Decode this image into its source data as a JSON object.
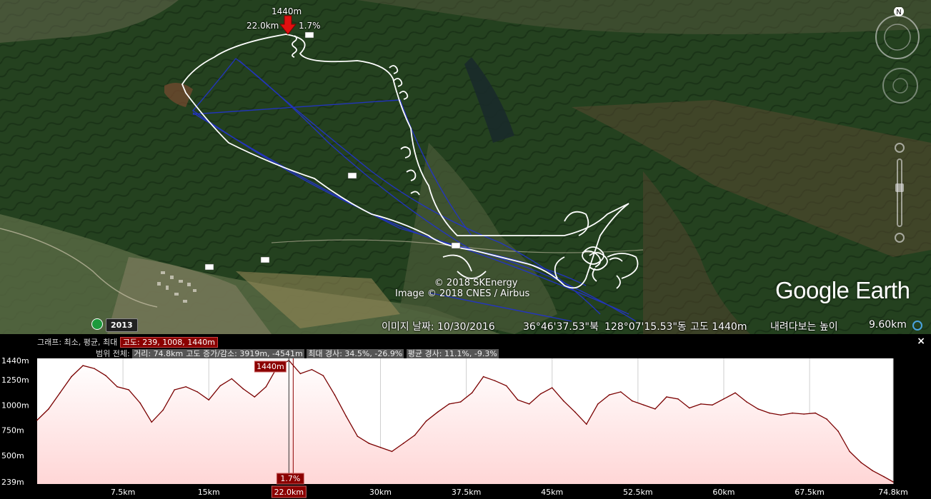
{
  "map": {
    "cursor_altitude": "1440m",
    "cursor_distance": "22.0km",
    "cursor_grade": "1.7%",
    "copyright_line1": "© 2018 SKEnergy",
    "copyright_line2": "Image © 2018 CNES / Airbus",
    "logo": "Google Earth",
    "historical_year": "2013",
    "status": {
      "image_date": "이미지 날짜: 10/30/2016",
      "latitude": "36°46'37.53\"북",
      "longitude": "128°07'15.53\"동",
      "elevation": "고도 1440m",
      "eye_alt": "내려다보는 높이",
      "eye_alt_value": "9.60km"
    },
    "compass_letter": "N"
  },
  "profile": {
    "graph_label": "그래프: 최소, 평균, 최대",
    "graph_values": "고도: 239, 1008, 1440m",
    "range_label": "범위 전체:",
    "range_distance": "거리: 74.8km",
    "range_gain": "고도 증가/감소: 3919m, -4541m",
    "range_slope_max": "최대 경사: 34.5%, -26.9%",
    "range_slope_avg": "평균 경사: 11.1%, -9.3%",
    "marker_alt": "1440m",
    "marker_grade": "1.7%",
    "marker_distance": "22.0km",
    "close": "×"
  },
  "chart_data": {
    "type": "area",
    "title": "",
    "xlabel": "",
    "ylabel": "",
    "xlim": [
      0,
      74.8
    ],
    "ylim": [
      239,
      1440
    ],
    "y_ticks": [
      "1440m",
      "1250m",
      "1000m",
      "750m",
      "500m",
      "239m"
    ],
    "x_ticks": [
      "7.5km",
      "15km",
      "22.0km",
      "30km",
      "37.5km",
      "45km",
      "52.5km",
      "60km",
      "67.5km",
      "74.8km"
    ],
    "x": [
      0,
      1,
      2,
      3,
      4,
      5,
      6,
      7,
      8,
      9,
      10,
      11,
      12,
      13,
      14,
      15,
      16,
      17,
      18,
      19,
      20,
      21,
      22,
      23,
      24,
      25,
      26,
      27,
      28,
      29,
      30,
      31,
      32,
      33,
      34,
      35,
      36,
      37,
      38,
      39,
      40,
      41,
      42,
      43,
      44,
      45,
      46,
      47,
      48,
      49,
      50,
      51,
      52,
      53,
      54,
      55,
      56,
      57,
      58,
      59,
      60,
      61,
      62,
      63,
      64,
      65,
      66,
      67,
      68,
      69,
      70,
      71,
      72,
      73,
      74,
      74.8
    ],
    "series": [
      {
        "values": [
          850,
          960,
          1120,
          1280,
          1390,
          1360,
          1290,
          1180,
          1150,
          1020,
          830,
          950,
          1150,
          1180,
          1130,
          1050,
          1190,
          1260,
          1160,
          1080,
          1180,
          1380,
          1440,
          1310,
          1350,
          1290,
          1100,
          890,
          690,
          620,
          580,
          540,
          620,
          700,
          840,
          930,
          1010,
          1030,
          1120,
          1280,
          1240,
          1190,
          1050,
          1010,
          1110,
          1170,
          1040,
          930,
          810,
          1010,
          1100,
          1130,
          1040,
          1000,
          960,
          1080,
          1060,
          970,
          1010,
          1000,
          1060,
          1120,
          1030,
          960,
          920,
          900,
          920,
          910,
          920,
          860,
          740,
          540,
          430,
          350,
          290,
          239
        ]
      }
    ],
    "marker_x": 22.0,
    "grid": true,
    "fill_color": "#ffd6d6",
    "line_color": "#7a0000"
  }
}
